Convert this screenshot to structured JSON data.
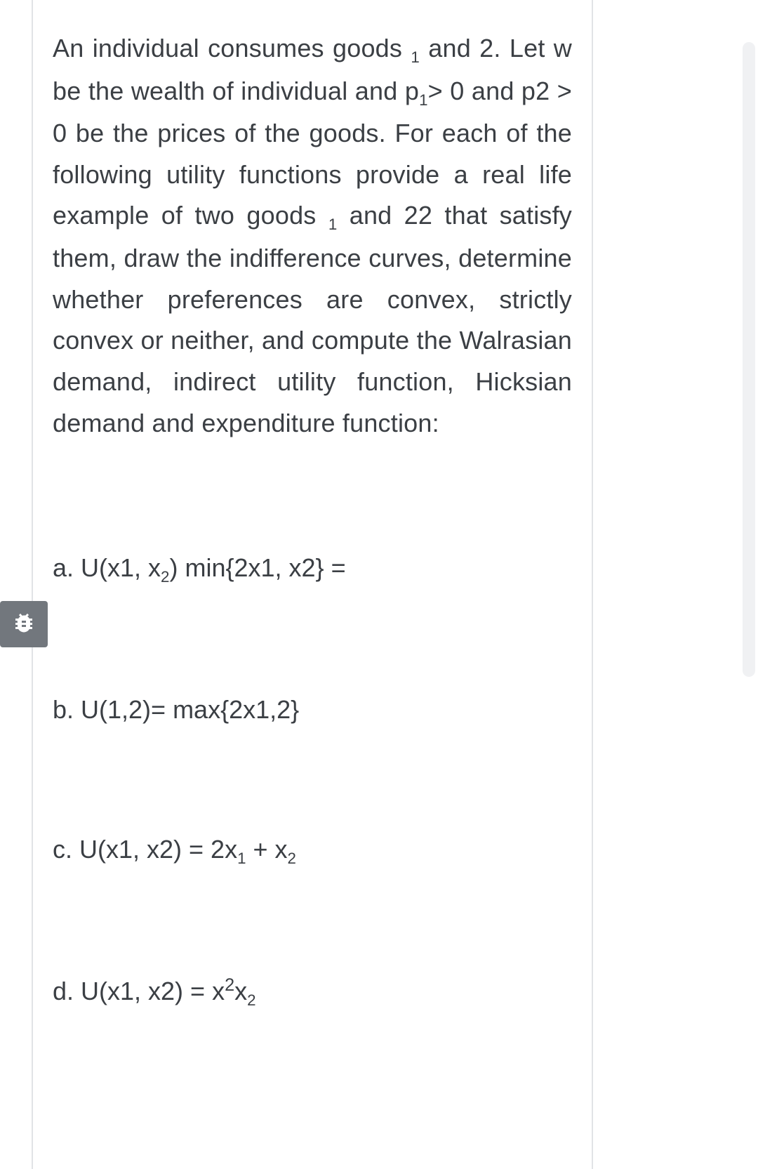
{
  "intro": {
    "pre1": "An individual consumes goods ",
    "sub1": "1",
    "mid1": " and 2. Let w be the wealth of individual and p",
    "sub2": "1",
    "mid2": "> 0 and p2 > 0 be the prices of the goods. For each of the following utility functions provide a real life example of two goods ",
    "sub3": "1",
    "mid3": " and 22 that satisfy them, draw the indifference curves, determine whether preferences are convex, strictly convex or neither, and compute the Walrasian demand, indirect utility function, Hicksian demand and expenditure function:"
  },
  "items": {
    "a": {
      "pre": "a. U(x1, x",
      "sub": "2",
      "post": ") min{2x1, x2} ="
    },
    "b": {
      "text": "b. U(1,2)= max{2x1,2}"
    },
    "c": {
      "pre": "c. U(x1, x2) = 2x",
      "sub1": "1",
      "mid": " + x",
      "sub2": "2"
    },
    "d": {
      "pre": "d. U(x1, x2) = x",
      "sup": "2",
      "mid": "x",
      "sub": "2"
    }
  }
}
